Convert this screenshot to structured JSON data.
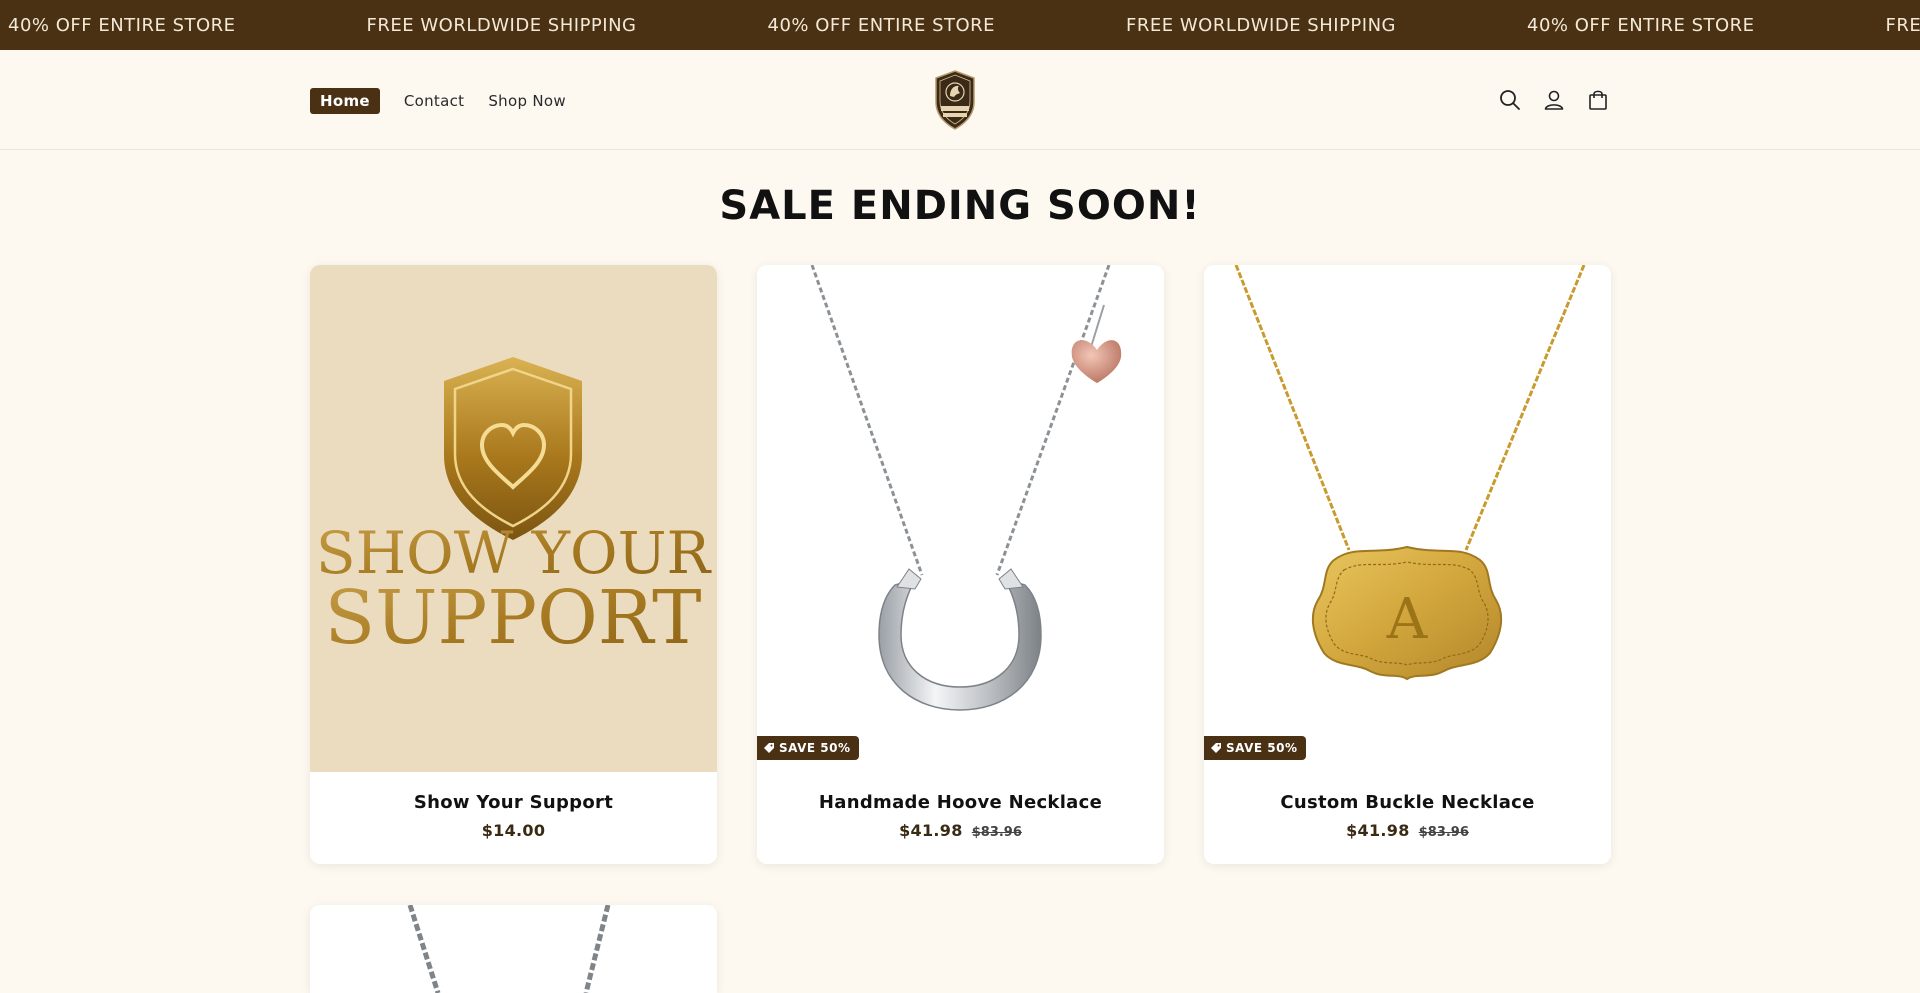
{
  "announcement": {
    "items": [
      "40% OFF ENTIRE STORE",
      "FREE WORLDWIDE SHIPPING",
      "40% OFF ENTIRE STORE",
      "FREE WORLDWIDE SHIPPING",
      "40% OFF ENTIRE STORE",
      "FREE WORLDWIDE SHIPPING"
    ]
  },
  "header": {
    "nav": [
      {
        "label": "Home",
        "active": true
      },
      {
        "label": "Contact",
        "active": false
      },
      {
        "label": "Shop Now",
        "active": false
      }
    ],
    "logo": {
      "alt": "Heritage Hooves",
      "text_line1": "HERITAGE",
      "text_line2": "HOOVES"
    },
    "icons": [
      "search-icon",
      "account-icon",
      "cart-icon"
    ]
  },
  "section": {
    "title": "SALE ENDING SOON!"
  },
  "products": [
    {
      "title": "Show Your Support",
      "price": "$14.00",
      "compare_price": "",
      "badge": "",
      "image_text_line1": "SHOW YOUR",
      "image_text_line2": "SUPPORT"
    },
    {
      "title": "Handmade Hoove Necklace",
      "price": "$41.98",
      "compare_price": "$83.96",
      "badge": "SAVE 50%"
    },
    {
      "title": "Custom Buckle Necklace",
      "price": "$41.98",
      "compare_price": "$83.96",
      "badge": "SAVE 50%",
      "image_letter": "A"
    }
  ],
  "colors": {
    "brand": "#4a3114",
    "background": "#fdf9f1",
    "gold": "#b88a22"
  }
}
